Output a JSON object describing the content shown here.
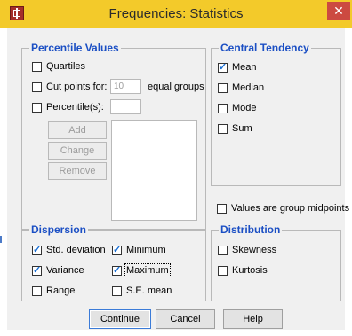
{
  "window": {
    "title": "Frequencies: Statistics",
    "close_glyph": "✕",
    "icon": "app-icon",
    "accent": "#f3ca2a"
  },
  "percentile_values": {
    "legend": "Percentile Values",
    "quartiles": {
      "label": "Quartiles",
      "checked": false
    },
    "cut_points": {
      "label": "Cut points for:",
      "value": "10",
      "suffix": "equal groups",
      "checked": false
    },
    "percentiles": {
      "label": "Percentile(s):",
      "value": "",
      "checked": false
    },
    "buttons": {
      "add": "Add",
      "change": "Change",
      "remove": "Remove"
    }
  },
  "central_tendency": {
    "legend": "Central Tendency",
    "items": [
      {
        "label": "Mean",
        "checked": true
      },
      {
        "label": "Median",
        "checked": false
      },
      {
        "label": "Mode",
        "checked": false
      },
      {
        "label": "Sum",
        "checked": false
      }
    ]
  },
  "group_midpoints": {
    "label": "Values are group midpoints",
    "checked": false
  },
  "dispersion": {
    "legend": "Dispersion",
    "items": [
      {
        "label": "Std. deviation",
        "checked": true
      },
      {
        "label": "Minimum",
        "checked": true
      },
      {
        "label": "Variance",
        "checked": true
      },
      {
        "label": "Maximum",
        "checked": true
      },
      {
        "label": "Range",
        "checked": false
      },
      {
        "label": "S.E. mean",
        "checked": false
      }
    ]
  },
  "distribution": {
    "legend": "Distribution",
    "items": [
      {
        "label": "Skewness",
        "checked": false
      },
      {
        "label": "Kurtosis",
        "checked": false
      }
    ]
  },
  "footer": {
    "continue": "Continue",
    "cancel": "Cancel",
    "help": "Help"
  }
}
